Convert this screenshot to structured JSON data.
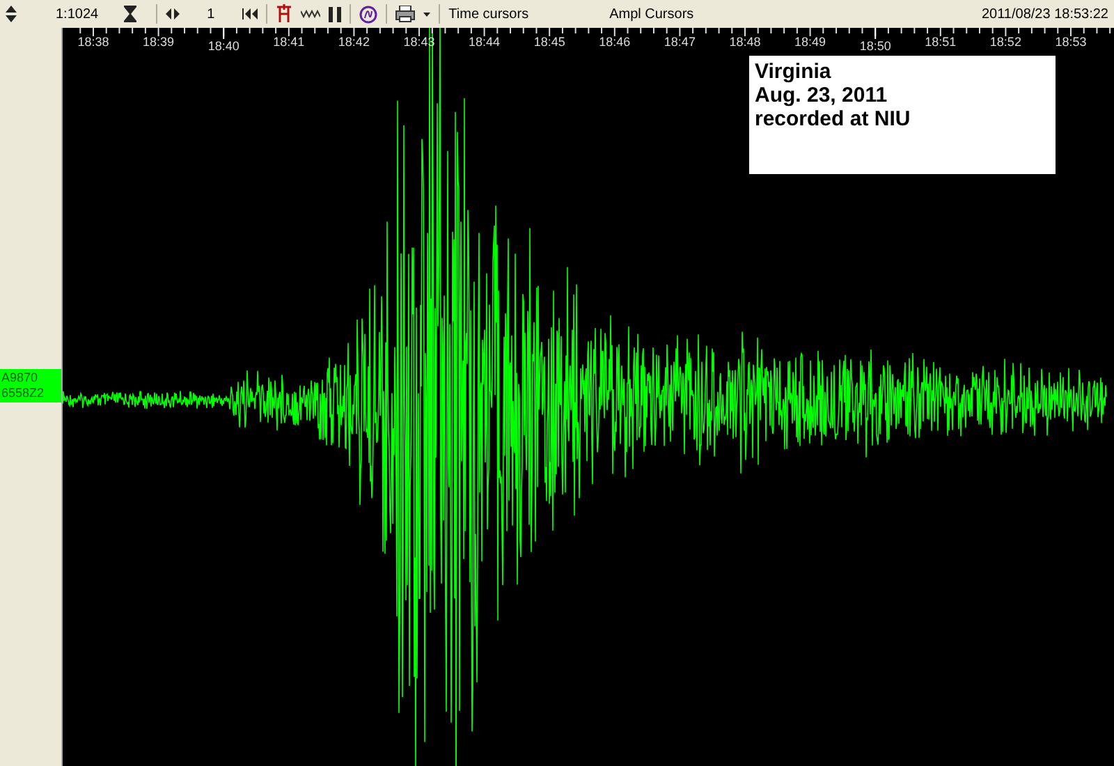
{
  "toolbar": {
    "scale": "1:1024",
    "step": "1",
    "time_cursors": "Time cursors",
    "ampl_cursors": "Ampl Cursors",
    "timestamp": "2011/08/23 18:53:22"
  },
  "time_axis": {
    "labels": [
      {
        "text": "18:38",
        "major": false
      },
      {
        "text": "18:39",
        "major": false
      },
      {
        "text": "18:40",
        "major": true
      },
      {
        "text": "18:41",
        "major": false
      },
      {
        "text": "18:42",
        "major": false
      },
      {
        "text": "18:43",
        "major": false
      },
      {
        "text": "18:44",
        "major": false
      },
      {
        "text": "18:45",
        "major": false
      },
      {
        "text": "18:46",
        "major": false
      },
      {
        "text": "18:47",
        "major": false
      },
      {
        "text": "18:48",
        "major": false
      },
      {
        "text": "18:49",
        "major": false
      },
      {
        "text": "18:50",
        "major": true
      },
      {
        "text": "18:51",
        "major": false
      },
      {
        "text": "18:52",
        "major": false
      },
      {
        "text": "18:53",
        "major": false
      }
    ]
  },
  "channel": {
    "lines": [
      "A9870",
      "6558Z2"
    ]
  },
  "annotation": {
    "lines": [
      "Virginia",
      "Aug. 23, 2011",
      "recorded at NIU"
    ]
  }
}
